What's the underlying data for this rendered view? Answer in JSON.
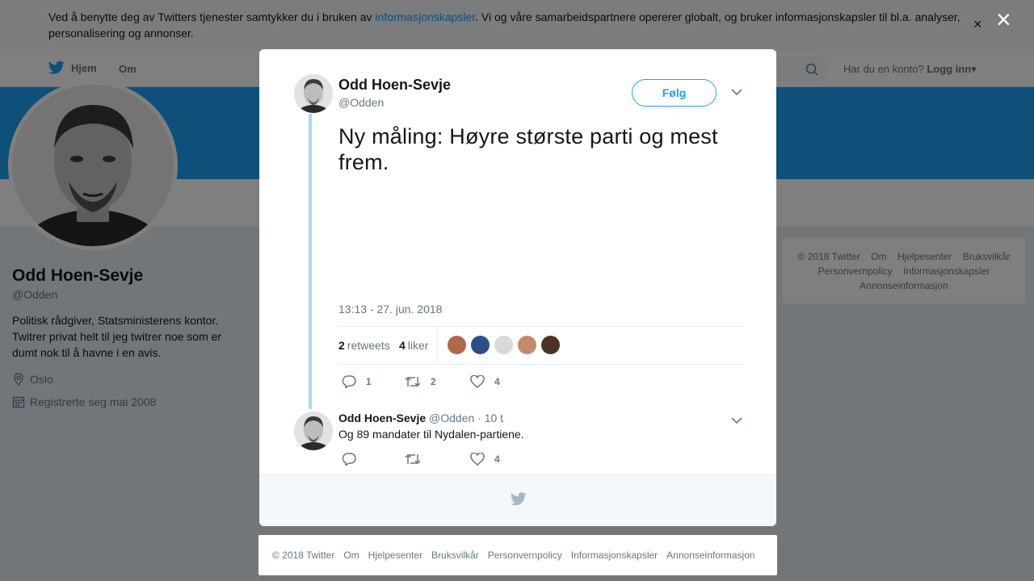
{
  "cookie_banner": {
    "text_before": "Ved å benytte deg av Twitters tjenester samtykker du i bruken av ",
    "link": "informasjonskapsler",
    "text_after": ". Vi og våre samarbeidspartnere opererer globalt, og bruker informasjonskapsler til bl.a. analyser, personalisering og annonser.",
    "close": "×"
  },
  "nav": {
    "home": "Hjem",
    "about": "Om",
    "account_prompt": "Har du en konto?",
    "login": "Logg inn",
    "login_caret": "▾"
  },
  "profile": {
    "name": "Odd Hoen-Sevje",
    "handle": "@Odden",
    "bio": "Politisk rådgiver, Statsministerens kontor. Twitrer privat helt til jeg twitrer noe som er dumt nok til å havne i en avis.",
    "location": "Oslo",
    "joined": "Registrerte seg mai 2008"
  },
  "side_footer": [
    "© 2018 Twitter",
    "Om",
    "Hjelpesenter",
    "Bruksvilkår",
    "Personvernpolicy",
    "Informasjonskapsler",
    "Annonseinformasjon"
  ],
  "overlay_close": "×",
  "tweet": {
    "name": "Odd Hoen-Sevje",
    "handle": "@Odden",
    "follow": "Følg",
    "text": "Ny måling: Høyre største parti og mest frem.",
    "timestamp": "13:13 - 27. jun. 2018",
    "retweets_count": "2",
    "retweets_label": "retweets",
    "likes_count": "4",
    "likes_label": "liker",
    "liker_colors": [
      "#b0684a",
      "#2c4f8a",
      "#d9d9d9",
      "#c38a6e",
      "#4a3424"
    ],
    "replies": "1",
    "retweets": "2",
    "likes": "4"
  },
  "reply": {
    "name": "Odd Hoen-Sevje",
    "handle": "@Odden",
    "time": "· 10 t",
    "text": "Og 89 mandater til Nydalen-partiene.",
    "retweets": "",
    "likes": "4"
  },
  "page_footer": [
    "© 2018 Twitter",
    "Om",
    "Hjelpesenter",
    "Bruksvilkår",
    "Personvernpolicy",
    "Informasjonskapsler",
    "Annonseinformasjon"
  ],
  "colors": {
    "accent": "#1da1f2",
    "thread": "#aad8f7"
  }
}
